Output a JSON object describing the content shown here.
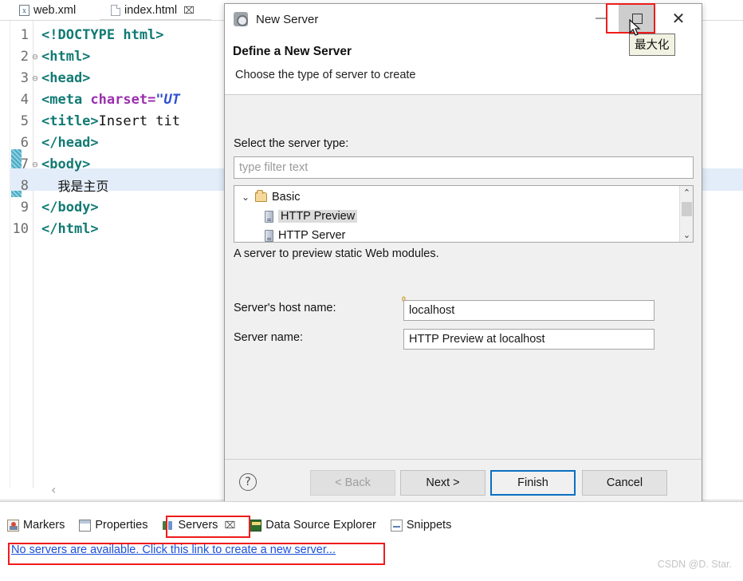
{
  "editor": {
    "tabs": [
      {
        "label": "web.xml",
        "icon": "xml-file-icon",
        "active": false,
        "closable": false
      },
      {
        "label": "index.html",
        "icon": "html-file-icon",
        "active": true,
        "closable": true,
        "close_glyph": "⌧"
      }
    ],
    "lines": [
      {
        "no": "1",
        "fold": "",
        "tokens": [
          {
            "t": "tag",
            "s": "<!DOCTYPE html>"
          }
        ]
      },
      {
        "no": "2",
        "fold": "⊖",
        "tokens": [
          {
            "t": "tag",
            "s": "<html>"
          }
        ]
      },
      {
        "no": "3",
        "fold": "⊖",
        "tokens": [
          {
            "t": "tag",
            "s": "<head>"
          }
        ]
      },
      {
        "no": "4",
        "fold": "",
        "tokens": [
          {
            "t": "tag",
            "s": "<meta "
          },
          {
            "t": "attr",
            "s": "charset="
          },
          {
            "t": "val",
            "s": "\"UT"
          }
        ]
      },
      {
        "no": "5",
        "fold": "",
        "tokens": [
          {
            "t": "tag",
            "s": "<title>"
          },
          {
            "t": "txt",
            "s": "Insert tit"
          }
        ]
      },
      {
        "no": "6",
        "fold": "",
        "tokens": [
          {
            "t": "tag",
            "s": "</head>"
          }
        ]
      },
      {
        "no": "7",
        "fold": "⊖",
        "tokens": [
          {
            "t": "tag",
            "s": "<body>"
          }
        ]
      },
      {
        "no": "8",
        "fold": "",
        "tokens": [
          {
            "t": "cn",
            "s": "    我是主页"
          }
        ]
      },
      {
        "no": "9",
        "fold": "",
        "tokens": [
          {
            "t": "tag",
            "s": "</body>"
          }
        ]
      },
      {
        "no": "10",
        "fold": "",
        "tokens": [
          {
            "t": "tag",
            "s": "</html>"
          }
        ]
      }
    ],
    "scroll_left_glyph": "‹"
  },
  "dialog": {
    "window_title": "New Server",
    "window_icon": "new-server-icon",
    "minimize_label": "—",
    "maximize_label": "□",
    "close_label": "✕",
    "header_title": "Define a New Server",
    "header_subtitle": "Choose the type of server to create",
    "select_label": "Select the server type:",
    "filter_placeholder": "type filter text",
    "filter_value": "",
    "tree": [
      {
        "label": "Basic",
        "type": "folder",
        "twisty": "⌄",
        "indent": 8,
        "selected": false
      },
      {
        "label": "HTTP Preview",
        "type": "server",
        "twisty": "",
        "indent": 38,
        "selected": true
      },
      {
        "label": "HTTP Server",
        "type": "server",
        "twisty": "",
        "indent": 38,
        "selected": false
      }
    ],
    "scroll_up_glyph": "⌃",
    "scroll_down_glyph": "⌄",
    "description": "A server to preview static Web modules.",
    "host_label": "Server's host name:",
    "host_value": "localhost",
    "host_required_mark": "0",
    "name_label": "Server name:",
    "name_value": "HTTP Preview at localhost",
    "help_glyph": "?",
    "buttons": [
      {
        "label": "< Back",
        "state": "disabled"
      },
      {
        "label": "Next >",
        "state": "normal"
      },
      {
        "label": "Finish",
        "state": "default"
      },
      {
        "label": "Cancel",
        "state": "normal"
      }
    ]
  },
  "tooltip": {
    "text": "最大化"
  },
  "bottom": {
    "tabs": [
      {
        "label": "Markers",
        "icon": "markers-icon",
        "selected": false,
        "closable": false
      },
      {
        "label": "Properties",
        "icon": "properties-icon",
        "selected": false,
        "closable": false
      },
      {
        "label": "Servers",
        "icon": "servers-icon",
        "selected": true,
        "closable": true,
        "close_glyph": "⌧"
      },
      {
        "label": "Data Source Explorer",
        "icon": "data-source-explorer-icon",
        "selected": false,
        "closable": false
      },
      {
        "label": "Snippets",
        "icon": "snippets-icon",
        "selected": false,
        "closable": false
      }
    ],
    "empty_link": "No servers are available. Click this link to create a new server..."
  },
  "watermark": "CSDN @D. Star.",
  "colors": {
    "highlight_red": "#ef1c1c",
    "link_blue": "#1b4fd8",
    "selection_blue": "#e3edf9",
    "default_button_border": "#0a6fc2"
  }
}
